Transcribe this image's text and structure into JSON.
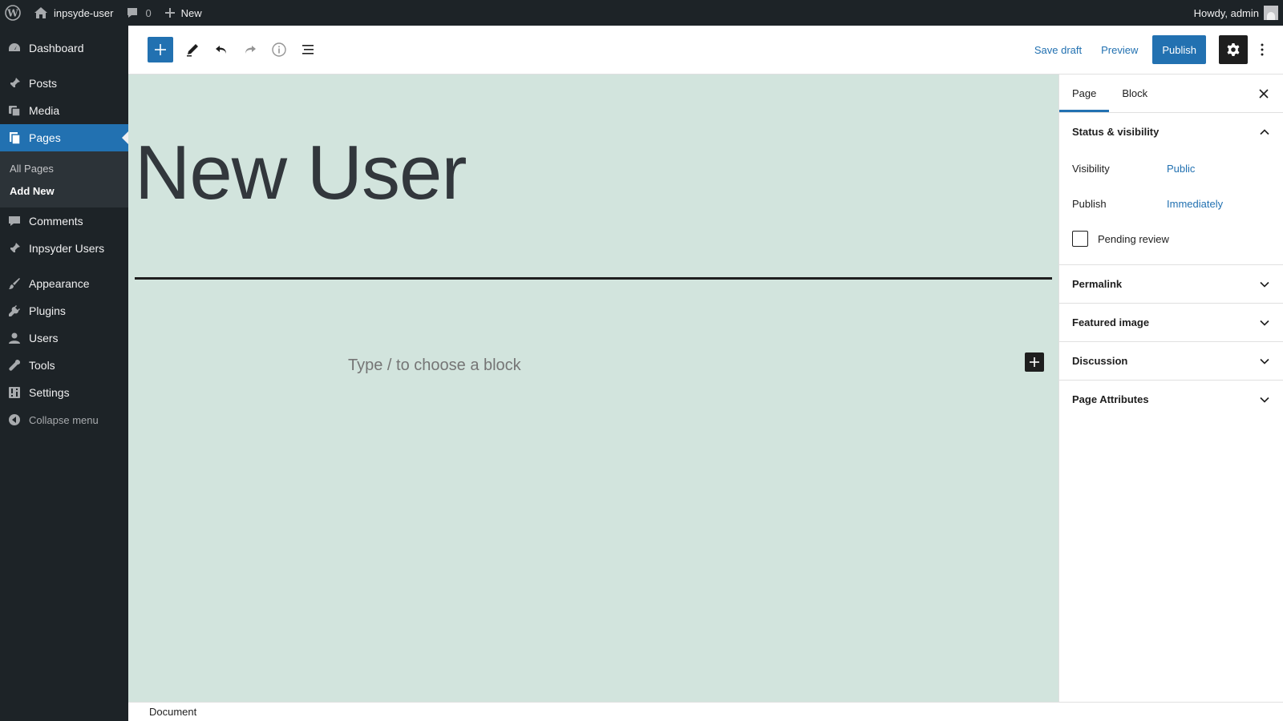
{
  "adminbar": {
    "site_name": "inpsyde-user",
    "comments_count": "0",
    "new_label": "New",
    "howdy": "Howdy, admin"
  },
  "sidebar": {
    "items": [
      {
        "label": "Dashboard",
        "icon": "dashboard-icon"
      },
      {
        "label": "Posts",
        "icon": "pin-icon"
      },
      {
        "label": "Media",
        "icon": "media-icon"
      },
      {
        "label": "Pages",
        "icon": "pages-icon",
        "current": true
      },
      {
        "label": "Comments",
        "icon": "comment-icon"
      },
      {
        "label": "Inpsyder Users",
        "icon": "pin-icon"
      },
      {
        "label": "Appearance",
        "icon": "brush-icon"
      },
      {
        "label": "Plugins",
        "icon": "plug-icon"
      },
      {
        "label": "Users",
        "icon": "user-icon"
      },
      {
        "label": "Tools",
        "icon": "wrench-icon"
      },
      {
        "label": "Settings",
        "icon": "sliders-icon"
      }
    ],
    "submenu": [
      {
        "label": "All Pages"
      },
      {
        "label": "Add New",
        "current": true
      }
    ],
    "collapse_label": "Collapse menu"
  },
  "header": {
    "save_draft": "Save draft",
    "preview": "Preview",
    "publish": "Publish"
  },
  "canvas": {
    "title": "New User",
    "placeholder": "Type / to choose a block",
    "background": "#d2e4dd"
  },
  "footer": {
    "breadcrumb": "Document"
  },
  "settings": {
    "tabs": [
      {
        "label": "Page",
        "active": true
      },
      {
        "label": "Block"
      }
    ],
    "status_panel": {
      "title": "Status & visibility",
      "visibility_label": "Visibility",
      "visibility_value": "Public",
      "publish_label": "Publish",
      "publish_value": "Immediately",
      "pending_label": "Pending review",
      "pending_checked": false
    },
    "panels": [
      {
        "title": "Permalink"
      },
      {
        "title": "Featured image"
      },
      {
        "title": "Discussion"
      },
      {
        "title": "Page Attributes"
      }
    ]
  },
  "colors": {
    "accent": "#2271b1",
    "admin_dark": "#1d2327"
  }
}
